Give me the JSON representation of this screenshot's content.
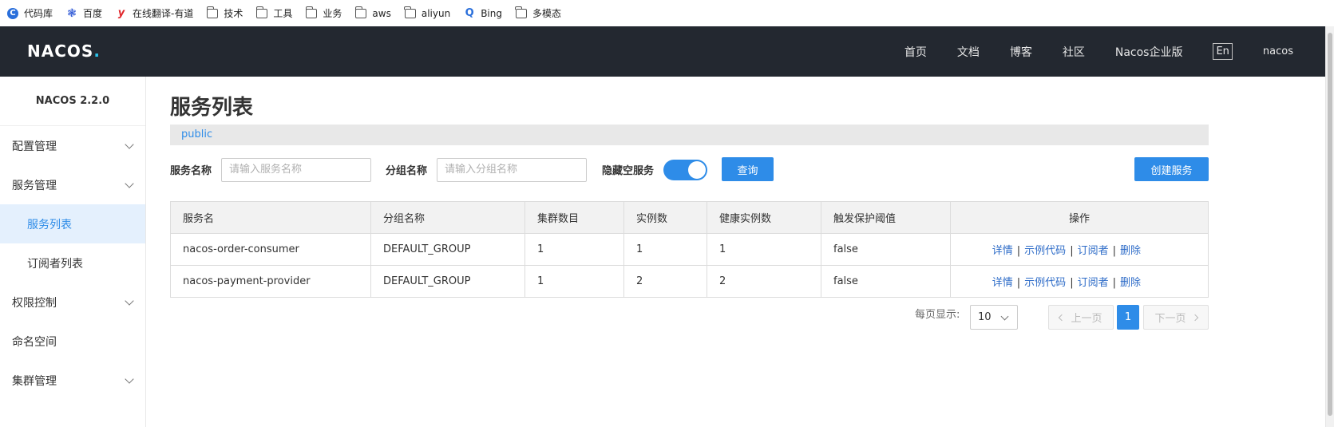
{
  "bookmarks": [
    {
      "label": "代码库",
      "icon": "circle-c-icon"
    },
    {
      "label": "百度",
      "icon": "baidu-paw-icon"
    },
    {
      "label": "在线翻译-有道",
      "icon": "youdao-icon"
    },
    {
      "label": "技术",
      "icon": "folder-icon"
    },
    {
      "label": "工具",
      "icon": "folder-icon"
    },
    {
      "label": "业务",
      "icon": "folder-icon"
    },
    {
      "label": "aws",
      "icon": "folder-icon"
    },
    {
      "label": "aliyun",
      "icon": "folder-icon"
    },
    {
      "label": "Bing",
      "icon": "search-icon"
    },
    {
      "label": "多模态",
      "icon": "folder-icon"
    }
  ],
  "topnav": {
    "logo_text": "NACOS",
    "logo_dot": ".",
    "links": [
      "首页",
      "文档",
      "博客",
      "社区",
      "Nacos企业版"
    ],
    "lang": "En",
    "user": "nacos"
  },
  "sidebar": {
    "version": "NACOS 2.2.0",
    "items": [
      {
        "label": "配置管理"
      },
      {
        "label": "服务管理"
      },
      {
        "label": "服务列表"
      },
      {
        "label": "订阅者列表"
      },
      {
        "label": "权限控制"
      },
      {
        "label": "命名空间"
      },
      {
        "label": "集群管理"
      }
    ]
  },
  "main": {
    "title": "服务列表",
    "namespace": "public",
    "filters": {
      "service_name_label": "服务名称",
      "service_name_placeholder": "请输入服务名称",
      "group_name_label": "分组名称",
      "group_name_placeholder": "请输入分组名称",
      "hide_empty_label": "隐藏空服务",
      "hide_empty_on": true,
      "query_button": "查询",
      "create_button": "创建服务"
    },
    "table": {
      "headers": [
        "服务名",
        "分组名称",
        "集群数目",
        "实例数",
        "健康实例数",
        "触发保护阈值",
        "操作"
      ],
      "rows": [
        {
          "service": "nacos-order-consumer",
          "group": "DEFAULT_GROUP",
          "clusters": "1",
          "instances": "1",
          "healthy": "1",
          "threshold": "false"
        },
        {
          "service": "nacos-payment-provider",
          "group": "DEFAULT_GROUP",
          "clusters": "1",
          "instances": "2",
          "healthy": "2",
          "threshold": "false"
        }
      ],
      "ops": [
        "详情",
        "示例代码",
        "订阅者",
        "删除"
      ],
      "ops_separator": "|"
    },
    "pagination": {
      "page_size_label": "每页显示:",
      "page_size": "10",
      "prev": "上一页",
      "next": "下一页",
      "current": "1"
    }
  },
  "colors": {
    "accent": "#2e8ce8",
    "nav_bg": "#232830",
    "link": "#2e6cc8"
  }
}
